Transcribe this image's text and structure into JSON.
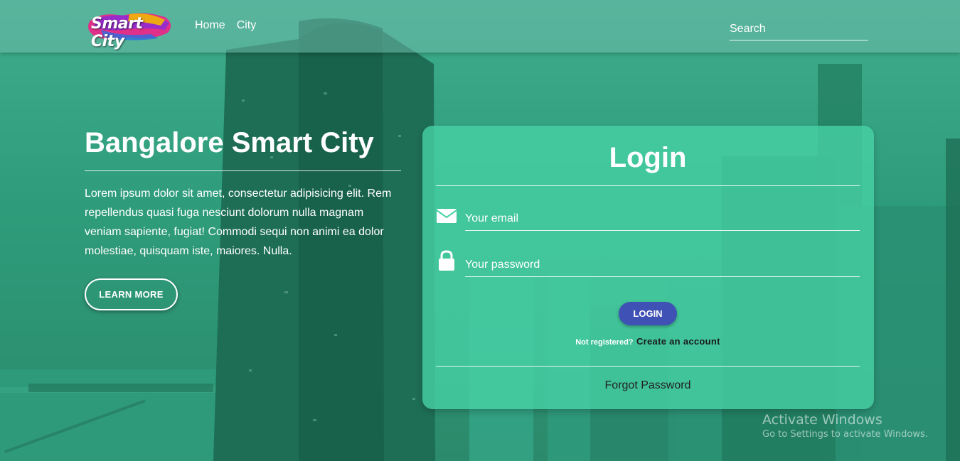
{
  "colors": {
    "background": "#3fae8c",
    "card": "#48d2a5",
    "login_button": "#3f51b5",
    "link_dark": "#1a1a1a"
  },
  "navbar": {
    "logo_text": "Smart City",
    "links": [
      {
        "label": "Home"
      },
      {
        "label": "City"
      }
    ],
    "search_placeholder": "Search"
  },
  "hero": {
    "title": "Bangalore Smart City",
    "description": "Lorem ipsum dolor sit amet, consectetur adipisicing elit. Rem repellendus quasi fuga nesciunt dolorum nulla magnam veniam sapiente, fugiat! Commodi sequi non animi ea dolor molestiae, quisquam iste, maiores. Nulla.",
    "button_label": "LEARN MORE"
  },
  "login": {
    "title": "Login",
    "email": {
      "icon": "envelope-icon",
      "placeholder": "Your email",
      "value": ""
    },
    "password": {
      "icon": "lock-icon",
      "placeholder": "Your password",
      "value": ""
    },
    "button_label": "LOGIN",
    "register_prompt": "Not registered?",
    "register_link": "Create an account",
    "forgot_link": "Forgot Password"
  },
  "watermark": {
    "title": "Activate Windows",
    "subtitle": "Go to Settings to activate Windows."
  }
}
